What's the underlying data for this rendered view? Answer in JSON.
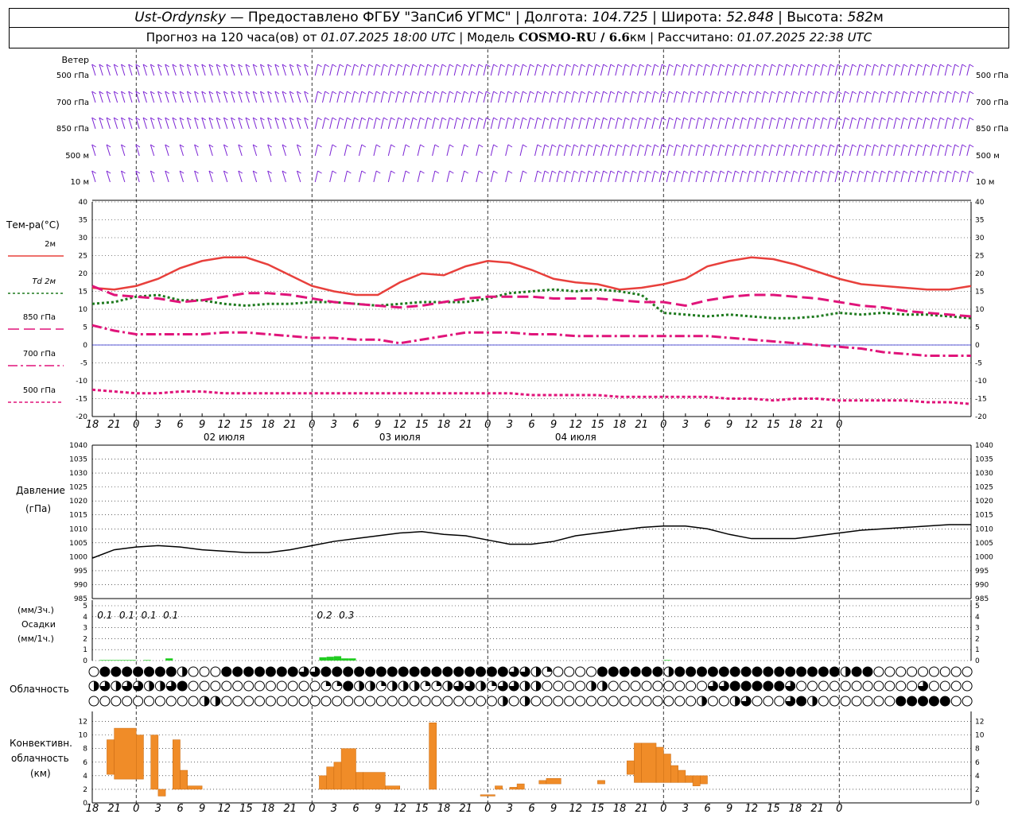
{
  "header": {
    "station": "Ust-Ordynsky",
    "dash": " — ",
    "provider": "Предоставлено ФГБУ \"ЗапСиб УГМС\"",
    "sep": " | ",
    "lon_label": "Долгота: ",
    "lon": "104.725",
    "lat_label": "Широта: ",
    "lat": "52.848",
    "alt_label": "Высота: ",
    "alt": "582",
    "alt_unit": "м",
    "forecast_label": "Прогноз на 120 часа(ов) от ",
    "forecast_time": "01.07.2025 18:00 UTC",
    "model_label": "Модель ",
    "model": "COSMO-RU / 6.6",
    "model_unit": "км",
    "calc_label": "Рассчитано: ",
    "calc_time": "01.07.2025 22:38 UTC"
  },
  "labels": {
    "wind": "Ветер",
    "wind_levels": [
      "500 гПа",
      "700 гПа",
      "850 гПа",
      "500  м",
      "10   м"
    ],
    "temp_title": "Тем-ра(°C)",
    "legend": [
      {
        "label": "2м",
        "color": "#e8403c",
        "dash": ""
      },
      {
        "label": "Td  2м",
        "color": "#1e7a1e",
        "dash": "3,3"
      },
      {
        "label": "850 гПа",
        "color": "#e0147a",
        "dash": "14,6"
      },
      {
        "label": "700 гПа",
        "color": "#e0147a",
        "dash": "12,4,3,4"
      },
      {
        "label": "500 гПа",
        "color": "#e0147a",
        "dash": "4,3"
      }
    ],
    "pressure_title_1": "Давление",
    "pressure_title_2": "(гПа)",
    "precip_title_1": "(мм/3ч.)",
    "precip_title_2": "Осадки",
    "precip_title_3": "(мм/1ч.)",
    "cloud_title": "Облачность",
    "conv_title_1": "Конвективн.",
    "conv_title_2": "облачность",
    "conv_title_3": "(км)",
    "dates": [
      "02 июля",
      "03 июля",
      "04 июля"
    ]
  },
  "chart_data": [
    {
      "type": "line",
      "title": "Тем-ра(°C)",
      "x_hours": [
        0,
        3,
        6,
        9,
        12,
        15,
        18,
        21,
        24,
        27,
        30,
        33,
        36,
        39,
        42,
        45,
        48,
        51,
        54,
        57,
        60,
        63,
        66,
        69,
        72,
        75,
        78,
        81,
        84,
        87,
        90,
        93,
        96,
        99,
        102,
        105,
        108,
        111,
        114,
        117,
        120
      ],
      "x_tick_labels": [
        "18",
        "21",
        "0",
        "3",
        "6",
        "9",
        "12",
        "15",
        "18",
        "21",
        "0",
        "3",
        "6",
        "9",
        "12",
        "15",
        "18",
        "21",
        "0",
        "3",
        "6",
        "9",
        "12",
        "15",
        "18",
        "21",
        "0",
        "3",
        "6",
        "9",
        "12",
        "15",
        "18",
        "21",
        "0"
      ],
      "ylim": [
        -20,
        40
      ],
      "series": [
        {
          "name": "2м",
          "color": "#e8403c",
          "values": [
            16,
            15.5,
            16.5,
            18.5,
            21.5,
            23.5,
            24.5,
            24.5,
            22.5,
            19.5,
            16.5,
            15,
            14,
            14,
            17.5,
            20,
            19.5,
            22,
            23.5,
            23,
            21,
            18.5,
            17.5,
            17,
            15.5,
            16,
            17,
            18.5,
            22,
            23.5,
            24.5,
            24,
            22.5,
            20.5,
            18.5,
            17,
            16.5,
            16,
            15.5,
            15.5,
            16.5
          ]
        },
        {
          "name": "Td  2м",
          "color": "#1e7a1e",
          "values": [
            11.5,
            12,
            13.5,
            14,
            12.5,
            12.5,
            11.5,
            11,
            11.5,
            11.5,
            12,
            12,
            11.5,
            11,
            11.5,
            12,
            12,
            12,
            13,
            14.5,
            15,
            15.5,
            15,
            15.5,
            15,
            14,
            9,
            8.5,
            8,
            8.5,
            8,
            7.5,
            7.5,
            8,
            9,
            8.5,
            9,
            8.5,
            8.5,
            8,
            7.5
          ]
        },
        {
          "name": "850 гПа",
          "color": "#e0147a",
          "values": [
            16.5,
            14,
            13.5,
            13,
            12,
            12.5,
            13.5,
            14.5,
            14.5,
            14,
            13,
            12,
            11.5,
            11,
            10.5,
            11,
            12,
            13,
            13.5,
            13.5,
            13.5,
            13,
            13,
            13,
            12.5,
            12,
            12,
            11,
            12.5,
            13.5,
            14,
            14,
            13.5,
            13,
            12,
            11,
            10.5,
            9.5,
            9,
            8.5,
            8
          ]
        },
        {
          "name": "700 гПа",
          "color": "#e0147a",
          "values": [
            5.5,
            4,
            3,
            3,
            3,
            3,
            3.5,
            3.5,
            3,
            2.5,
            2,
            2,
            1.5,
            1.5,
            0.5,
            1.5,
            2.5,
            3.5,
            3.5,
            3.5,
            3,
            3,
            2.5,
            2.5,
            2.5,
            2.5,
            2.5,
            2.5,
            2.5,
            2,
            1.5,
            1,
            0.5,
            0,
            -0.5,
            -1,
            -2,
            -2.5,
            -3,
            -3,
            -3
          ]
        },
        {
          "name": "500 гПа",
          "color": "#e0147a",
          "values": [
            -12.5,
            -13,
            -13.5,
            -13.5,
            -13,
            -13,
            -13.5,
            -13.5,
            -13.5,
            -13.5,
            -13.5,
            -13.5,
            -13.5,
            -13.5,
            -13.5,
            -13.5,
            -13.5,
            -13.5,
            -13.5,
            -13.5,
            -14,
            -14,
            -14,
            -14,
            -14.5,
            -14.5,
            -14.5,
            -14.5,
            -14.5,
            -15,
            -15,
            -15.5,
            -15,
            -15,
            -15.5,
            -15.5,
            -15.5,
            -15.5,
            -16,
            -16,
            -16.5
          ]
        }
      ]
    },
    {
      "type": "line",
      "title": "Давление (гПа)",
      "x_hours": [
        0,
        3,
        6,
        9,
        12,
        15,
        18,
        21,
        24,
        27,
        30,
        33,
        36,
        39,
        42,
        45,
        48,
        51,
        54,
        57,
        60,
        63,
        66,
        69,
        72,
        75,
        78,
        81,
        84,
        87,
        90,
        93,
        96,
        99,
        102,
        105,
        108,
        111,
        114,
        117,
        120
      ],
      "ylim": [
        985,
        1040
      ],
      "series": [
        {
          "name": "",
          "color": "#000000",
          "values": [
            999.5,
            1002.5,
            1003.5,
            1004,
            1003.5,
            1002.5,
            1002,
            1001.5,
            1001.5,
            1002.5,
            1004,
            1005.5,
            1006.5,
            1007.5,
            1008.5,
            1009,
            1008,
            1007.5,
            1006,
            1004.5,
            1004.5,
            1005.5,
            1007.5,
            1008.5,
            1009.5,
            1010.5,
            1011,
            1011,
            1010,
            1008,
            1006.5,
            1006.5,
            1006.5,
            1007.5,
            1008.5,
            1009.5,
            1010,
            1010.5,
            1011,
            1011.5,
            1011.5
          ]
        }
      ]
    },
    {
      "type": "bar",
      "title": "Осадки",
      "ylim": [
        0,
        5
      ],
      "ytick_labels": [
        "0",
        "1",
        "2",
        "3",
        "4",
        "5"
      ],
      "values_3h_labels": [
        {
          "hour": 1.5,
          "text": "0.1"
        },
        {
          "hour": 4.5,
          "text": "0.1"
        },
        {
          "hour": 7.5,
          "text": "0.1"
        },
        {
          "hour": 10.5,
          "text": "0.1"
        },
        {
          "hour": 31.5,
          "text": "0.2"
        },
        {
          "hour": 34.5,
          "text": "0.3"
        }
      ],
      "hourly_mm": [
        {
          "hour": 2,
          "value": 0.05
        },
        {
          "hour": 3,
          "value": 0.05
        },
        {
          "hour": 4,
          "value": 0.05
        },
        {
          "hour": 5,
          "value": 0.05
        },
        {
          "hour": 6,
          "value": 0.05
        },
        {
          "hour": 8,
          "value": 0.05
        },
        {
          "hour": 11,
          "value": 0.2
        },
        {
          "hour": 32,
          "value": 0.3
        },
        {
          "hour": 33,
          "value": 0.35
        },
        {
          "hour": 34,
          "value": 0.4
        },
        {
          "hour": 35,
          "value": 0.2
        },
        {
          "hour": 36,
          "value": 0.2
        },
        {
          "hour": 79,
          "value": 0.05
        }
      ],
      "color": "#22cc22"
    },
    {
      "type": "table",
      "title": "Облачность",
      "rows_fraction": [
        [
          0,
          1,
          1,
          1,
          1,
          1,
          1,
          1,
          0.5,
          0,
          0,
          0,
          1,
          1,
          1,
          1,
          1,
          1,
          1,
          0.75,
          0.75,
          1,
          1,
          1,
          1,
          1,
          1,
          1,
          1,
          1,
          1,
          1,
          1,
          1,
          1,
          1,
          1,
          1,
          0.75,
          0.75,
          0.5,
          0.25,
          0,
          0,
          0,
          0,
          1,
          1,
          1,
          1,
          1,
          1,
          0.5,
          1,
          1,
          1,
          1,
          1,
          1,
          1,
          1,
          1,
          1,
          1,
          1,
          1,
          1,
          1,
          0.5,
          1,
          1,
          0,
          0,
          0,
          0,
          0,
          0,
          0,
          0,
          0,
          0,
          0,
          0,
          0,
          0,
          1,
          1,
          0.75,
          0.75,
          0.75,
          1,
          0.75,
          0,
          0,
          0,
          0,
          0,
          0,
          0,
          0,
          0,
          0,
          0,
          0,
          0,
          0,
          0,
          0,
          0,
          0,
          0,
          0,
          0.75
        ],
        [
          0.5,
          0.75,
          0.5,
          0.75,
          0.75,
          0.5,
          0.5,
          0.75,
          1,
          0,
          0,
          0,
          0,
          0,
          0,
          0,
          0,
          0,
          0,
          0,
          0,
          0.25,
          0.25,
          1,
          0.5,
          0.5,
          0.25,
          0.5,
          0.5,
          0.5,
          0.25,
          0.25,
          0.5,
          0.75,
          0.75,
          0.5,
          0.25,
          0.75,
          0.75,
          0.5,
          0.5,
          0,
          0,
          0,
          0,
          0.5,
          0.5,
          0,
          0,
          0,
          0,
          0,
          0,
          0,
          0,
          0,
          0.75,
          0.75,
          1,
          1,
          1,
          1,
          1,
          0.75,
          0,
          0,
          0,
          0,
          0,
          0,
          0,
          0,
          0,
          0,
          0,
          0.75,
          0,
          0,
          0,
          0,
          0,
          0,
          0,
          0,
          0,
          0,
          0,
          0,
          0,
          0,
          0,
          0,
          0,
          1,
          1,
          1,
          1,
          1,
          1,
          1,
          1,
          1,
          1,
          1,
          0.5,
          0,
          0,
          0,
          0,
          0,
          0,
          0,
          0,
          0,
          0,
          0,
          0,
          0.5
        ],
        [
          0,
          0,
          0,
          0,
          0,
          0,
          0,
          0,
          0,
          0,
          0.5,
          0.5,
          0,
          0,
          0,
          0,
          0,
          0,
          0,
          0,
          0,
          0,
          0,
          0,
          0,
          0,
          0,
          0,
          0,
          0,
          0,
          0,
          0,
          0,
          0,
          0,
          0,
          0.5,
          0,
          0.5,
          0,
          0,
          0,
          0,
          0,
          0,
          0,
          0,
          0,
          0,
          0,
          0,
          0,
          0,
          0,
          0.5,
          0,
          0,
          0.5,
          0.75,
          0,
          0,
          0,
          0.75,
          1,
          0.5,
          0,
          0,
          0,
          0,
          0,
          0,
          0,
          1,
          1,
          1,
          1,
          1,
          0,
          0,
          0,
          0,
          0,
          0,
          0,
          0,
          0,
          0,
          0,
          0,
          0,
          0,
          0,
          0,
          0,
          0,
          0,
          0,
          0,
          0,
          0,
          0,
          0,
          0,
          0,
          0,
          0,
          0,
          0,
          0,
          0,
          0,
          0,
          0,
          0,
          0.25,
          0,
          0
        ]
      ]
    },
    {
      "type": "bar",
      "title": "Конвективн. облачность (км)",
      "ylim": [
        0,
        13
      ],
      "ytick_labels": [
        "0",
        "2",
        "4",
        "6",
        "8",
        "10",
        "12"
      ],
      "color": "#f08c28",
      "bars_km": [
        {
          "from_h": 2,
          "to_h": 3,
          "base": 4.2,
          "top": 9.3
        },
        {
          "from_h": 3,
          "to_h": 6,
          "base": 3.5,
          "top": 11
        },
        {
          "from_h": 6,
          "to_h": 7,
          "base": 3.5,
          "top": 10
        },
        {
          "from_h": 8,
          "to_h": 9,
          "base": 2,
          "top": 10
        },
        {
          "from_h": 9,
          "to_h": 10,
          "base": 1,
          "top": 2
        },
        {
          "from_h": 11,
          "to_h": 12,
          "base": 2,
          "top": 9.3
        },
        {
          "from_h": 12,
          "to_h": 13,
          "base": 2,
          "top": 4.8
        },
        {
          "from_h": 13,
          "to_h": 15,
          "base": 2,
          "top": 2.5
        },
        {
          "from_h": 31,
          "to_h": 32,
          "base": 2,
          "top": 4
        },
        {
          "from_h": 32,
          "to_h": 33,
          "base": 2,
          "top": 5.3
        },
        {
          "from_h": 33,
          "to_h": 34,
          "base": 2,
          "top": 6
        },
        {
          "from_h": 34,
          "to_h": 36,
          "base": 2,
          "top": 8
        },
        {
          "from_h": 36,
          "to_h": 37,
          "base": 2,
          "top": 4.5
        },
        {
          "from_h": 37,
          "to_h": 40,
          "base": 2,
          "top": 4.5
        },
        {
          "from_h": 40,
          "to_h": 42,
          "base": 2,
          "top": 2.5
        },
        {
          "from_h": 46,
          "to_h": 47,
          "base": 2,
          "top": 11.8
        },
        {
          "from_h": 53,
          "to_h": 55,
          "base": 1,
          "top": 1.2
        },
        {
          "from_h": 55,
          "to_h": 56,
          "base": 2,
          "top": 2.5
        },
        {
          "from_h": 57,
          "to_h": 58,
          "base": 2,
          "top": 2.3
        },
        {
          "from_h": 58,
          "to_h": 59,
          "base": 2,
          "top": 2.8
        },
        {
          "from_h": 61,
          "to_h": 62,
          "base": 2.8,
          "top": 3.3
        },
        {
          "from_h": 62,
          "to_h": 64,
          "base": 2.8,
          "top": 3.6
        },
        {
          "from_h": 69,
          "to_h": 70,
          "base": 2.8,
          "top": 3.3
        },
        {
          "from_h": 73,
          "to_h": 74,
          "base": 4.2,
          "top": 6.2
        },
        {
          "from_h": 74,
          "to_h": 75,
          "base": 3,
          "top": 8.8
        },
        {
          "from_h": 75,
          "to_h": 77,
          "base": 3,
          "top": 8.8
        },
        {
          "from_h": 77,
          "to_h": 78,
          "base": 3,
          "top": 8.2
        },
        {
          "from_h": 78,
          "to_h": 79,
          "base": 3,
          "top": 7.2
        },
        {
          "from_h": 79,
          "to_h": 80,
          "base": 3,
          "top": 5.5
        },
        {
          "from_h": 80,
          "to_h": 81,
          "base": 3,
          "top": 4.8
        },
        {
          "from_h": 81,
          "to_h": 82,
          "base": 3,
          "top": 4
        },
        {
          "from_h": 82,
          "to_h": 83,
          "base": 2.5,
          "top": 4
        },
        {
          "from_h": 83,
          "to_h": 84,
          "base": 2.8,
          "top": 4
        }
      ]
    }
  ]
}
